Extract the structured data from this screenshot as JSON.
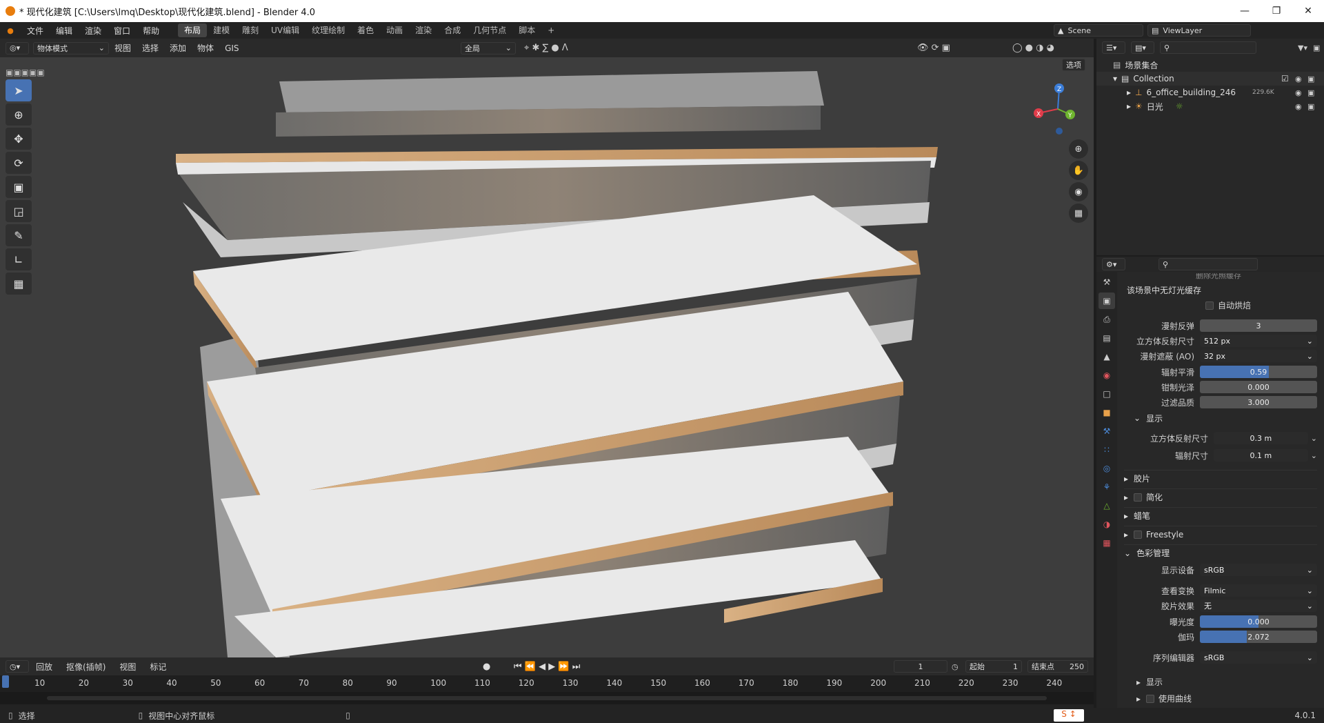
{
  "window": {
    "title": "* 现代化建筑 [C:\\Users\\lmq\\Desktop\\现代化建筑.blend] - Blender 4.0"
  },
  "menu": [
    "文件",
    "编辑",
    "渲染",
    "窗口",
    "帮助"
  ],
  "workspaces": [
    "布局",
    "建模",
    "雕刻",
    "UV编辑",
    "纹理绘制",
    "着色",
    "动画",
    "渲染",
    "合成",
    "几何节点",
    "脚本"
  ],
  "workspace_add": "+",
  "scene": {
    "name": "Scene",
    "view_layer": "ViewLayer"
  },
  "viewport_header": {
    "mode": "物体模式",
    "menus": [
      "视图",
      "选择",
      "添加",
      "物体",
      "GIS"
    ],
    "transform_orient": "全局",
    "options": "选项"
  },
  "outliner": {
    "root": "场景集合",
    "collection": "Collection",
    "objects": [
      {
        "name": "6_office_building_246",
        "badge": "229.6K"
      },
      {
        "name": "日光"
      }
    ]
  },
  "properties": {
    "top_cut": "删除光照缓存",
    "no_lightcache": "该场景中无灯光缓存",
    "auto_bake": "自动烘焙",
    "rows": [
      {
        "label": "漫射反弹",
        "value": "3",
        "kind": "num"
      },
      {
        "label": "立方体反射尺寸",
        "value": "512 px",
        "kind": "drop"
      },
      {
        "label": "漫射遮蔽 (AO)",
        "value": "32 px",
        "kind": "drop"
      },
      {
        "label": "辐射平滑",
        "value": "0.59",
        "kind": "slider",
        "fill": 0.59
      },
      {
        "label": "钳制光泽",
        "value": "0.000",
        "kind": "num"
      },
      {
        "label": "过滤品质",
        "value": "3.000",
        "kind": "num"
      }
    ],
    "display_section": "显示",
    "display_rows": [
      {
        "label": "立方体反射尺寸",
        "value": "0.3 m"
      },
      {
        "label": "辐射尺寸",
        "value": "0.1 m"
      }
    ],
    "sections": [
      "胶片",
      "简化",
      "蜡笔",
      "Freestyle",
      "色彩管理"
    ],
    "color_mgmt": [
      {
        "label": "显示设备",
        "value": "sRGB",
        "kind": "drop"
      },
      {
        "label": "查看变换",
        "value": "Filmic",
        "kind": "drop"
      },
      {
        "label": "胶片效果",
        "value": "无",
        "kind": "drop"
      },
      {
        "label": "曝光度",
        "value": "0.000",
        "kind": "slider",
        "fill": 0.5
      },
      {
        "label": "伽玛",
        "value": "2.072",
        "kind": "slider",
        "fill": 0.4
      },
      {
        "label": "序列编辑器",
        "value": "sRGB",
        "kind": "drop"
      }
    ],
    "sub_display": "显示",
    "use_curves": "使用曲线"
  },
  "timeline": {
    "menus": [
      "回放",
      "抠像(插帧)",
      "视图",
      "标记"
    ],
    "current_frame": "1",
    "start_label": "起始",
    "start": "1",
    "end_label": "结束点",
    "end": "250",
    "ticks": [
      "10",
      "20",
      "30",
      "40",
      "50",
      "60",
      "70",
      "80",
      "90",
      "100",
      "110",
      "120",
      "130",
      "140",
      "150",
      "160",
      "170",
      "180",
      "190",
      "200",
      "210",
      "220",
      "230",
      "240"
    ]
  },
  "status": {
    "select": "选择",
    "center": "视图中心对齐鼠标",
    "version": "4.0.1"
  },
  "colors": {
    "accent": "#4772b3",
    "wood": "#c9a274",
    "bg": "#3a3a3a"
  }
}
